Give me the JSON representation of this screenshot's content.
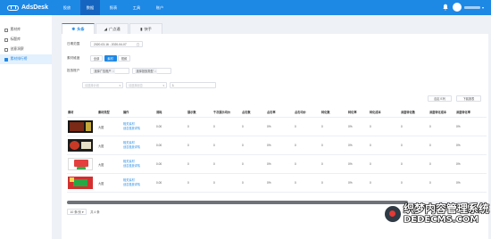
{
  "app": {
    "logo_text": "AdsDesk",
    "logo_icon": "ad-logo-icon"
  },
  "nav": [
    {
      "label": "投放",
      "active": false
    },
    {
      "label": "数据",
      "active": true
    },
    {
      "label": "报表",
      "active": false
    },
    {
      "label": "工具",
      "active": false
    },
    {
      "label": "账户",
      "active": false
    }
  ],
  "user": {
    "icons": [
      "bell-icon",
      "avatar-icon",
      "chevron-down-icon"
    ]
  },
  "sidebar": {
    "items": [
      {
        "label": "素材库",
        "icon": "folder-icon",
        "active": false
      },
      {
        "label": "标题库",
        "icon": "doc-icon",
        "active": false
      },
      {
        "label": "创意洞察",
        "icon": "bulb-icon",
        "active": false
      },
      {
        "label": "素材排行榜",
        "icon": "rank-icon",
        "active": true
      }
    ]
  },
  "tabs": [
    {
      "label": "头条",
      "icon": "gear-icon",
      "active": true
    },
    {
      "label": "广点通",
      "icon": "chart-icon",
      "active": false
    },
    {
      "label": "快手",
      "icon": "bars-icon",
      "active": false
    }
  ],
  "filters": {
    "date_label": "日期范围",
    "date_value": "2020-03-16 - 2020-04-07",
    "media_label": "素材维度",
    "media_options": [
      {
        "label": "全部",
        "active": false
      },
      {
        "label": "素材",
        "active": true
      },
      {
        "label": "视频",
        "active": false
      }
    ],
    "account_label": "投放账户",
    "account_chips": [
      "选择广告账户",
      "选择投放类型"
    ],
    "sel1_placeholder": "请选择计划",
    "sel2_placeholder": "请选择创意",
    "text_value": "1"
  },
  "actions": {
    "columns": "自定义列",
    "export": "下载报表"
  },
  "table": {
    "headers": [
      "素材",
      "素材类型",
      "操作",
      "消耗",
      "展示数",
      "千次展示均价",
      "点击数",
      "点击率",
      "点击均价",
      "转化数",
      "转化率",
      "转化成本",
      "深度转化数",
      "深度转化成本",
      "深度转化率"
    ],
    "rows": [
      {
        "thumb": "t0",
        "type": "大图",
        "op1": "相关素材",
        "op2": "创意投放详情",
        "cells": [
          "0.00",
          "0",
          "0",
          "0",
          "0%",
          "0",
          "0",
          "0%",
          "0",
          "0",
          "0",
          "0%"
        ]
      },
      {
        "thumb": "t1",
        "type": "大图",
        "op1": "相关素材",
        "op2": "创意投放详情",
        "cells": [
          "0.00",
          "0",
          "0",
          "0",
          "0%",
          "0",
          "0",
          "0%",
          "0",
          "0",
          "0",
          "0%"
        ]
      },
      {
        "thumb": "t2",
        "type": "大图",
        "op1": "相关素材",
        "op2": "创意投放详情",
        "cells": [
          "0.00",
          "0",
          "0",
          "0",
          "0%",
          "0",
          "0",
          "0%",
          "0",
          "0",
          "0",
          "0%"
        ]
      },
      {
        "thumb": "t3",
        "type": "大图",
        "op1": "相关素材",
        "op2": "创意投放详情",
        "cells": [
          "0.00",
          "0",
          "0",
          "0",
          "0%",
          "0",
          "0",
          "0%",
          "0",
          "0",
          "0",
          "0%"
        ]
      }
    ]
  },
  "pager": {
    "page_size": "10 条/页",
    "total": "共 4 条"
  },
  "watermark": {
    "line1": "织梦内容管理系统",
    "line2": "DEDECMS.COM"
  }
}
